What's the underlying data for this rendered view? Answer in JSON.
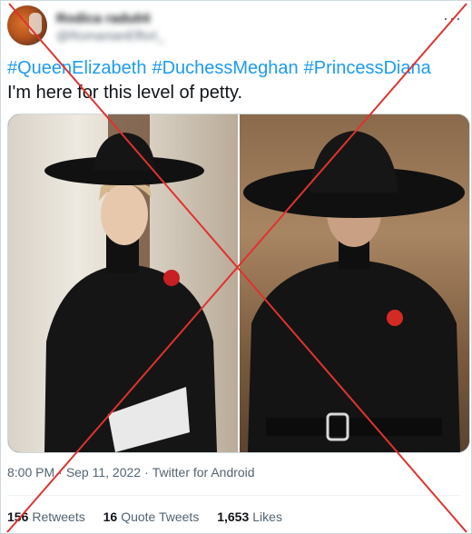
{
  "tweet": {
    "author_name": "Rodica radu04",
    "author_handle": "@RomanianEffort_",
    "hashtags": [
      "#QueenElizabeth",
      "#DuchessMeghan",
      "#PrincessDiana"
    ],
    "text": "I'm here for this level of petty.",
    "time": "8:00 PM",
    "date": "Sep 11, 2022",
    "source": "Twitter for Android",
    "separator": "·"
  },
  "stats": {
    "retweets_count": "156",
    "retweets_label": "Retweets",
    "quote_count": "16",
    "quote_label": "Quote Tweets",
    "likes_count": "1,653",
    "likes_label": "Likes"
  },
  "colors": {
    "accent": "#1d9bf0",
    "text": "#0f1419",
    "muted": "#536471",
    "cross": "#e0322f"
  },
  "icons": {
    "more": "more-horizontal-icon"
  }
}
